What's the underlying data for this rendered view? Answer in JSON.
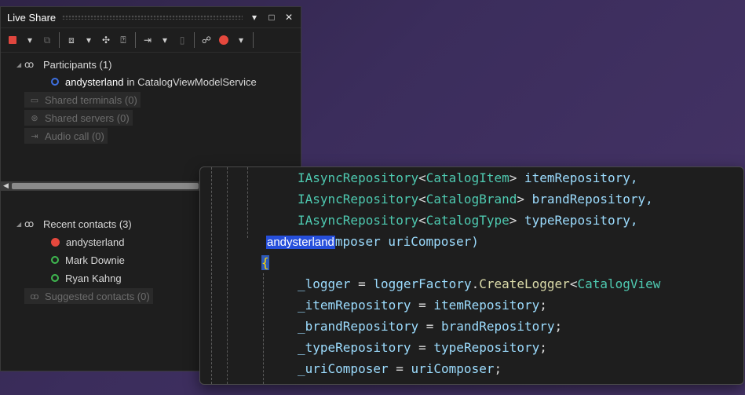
{
  "panel": {
    "title": "Live Share",
    "participants_label": "Participants (1)",
    "participant": {
      "name": "andysterland",
      "location": "in CatalogViewModelService"
    },
    "shared_terminals": "Shared terminals (0)",
    "shared_servers": "Shared servers (0)",
    "audio_call": "Audio call (0)",
    "recent_contacts_label": "Recent contacts (3)",
    "recent_contacts": [
      "andysterland",
      "Mark Downie",
      "Ryan Kahng"
    ],
    "suggested_contacts": "Suggested contacts (0)"
  },
  "editor": {
    "line1": {
      "type": "IAsyncRepository",
      "lt": "<",
      "generic": "CatalogItem",
      "gt": ">",
      "param": " itemRepository,",
      "indent": "        "
    },
    "line2": {
      "type": "IAsyncRepository",
      "lt": "<",
      "generic": "CatalogBrand",
      "gt": ">",
      "param": " brandRepository,",
      "indent": "        "
    },
    "line3": {
      "type": "IAsyncRepository",
      "lt": "<",
      "generic": "CatalogType",
      "gt": ">",
      "param": " typeRepository,",
      "indent": "        "
    },
    "line4": {
      "cursor_name": "andysterland",
      "rest": "mposer uriComposer)"
    },
    "line5": {
      "brace": "{"
    },
    "line6": {
      "lhs": "_logger",
      "eq": " = ",
      "obj": "loggerFactory",
      "dot": ".",
      "method": "CreateLogger",
      "lt": "<",
      "generic": "CatalogView"
    },
    "line7": {
      "lhs": "_itemRepository",
      "eq": " = ",
      "rhs": "itemRepository",
      "semi": ";"
    },
    "line8": {
      "lhs": "_brandRepository",
      "eq": " = ",
      "rhs": "brandRepository",
      "semi": ";"
    },
    "line9": {
      "lhs": "_typeRepository",
      "eq": " = ",
      "rhs": "typeRepository",
      "semi": ";"
    },
    "line10": {
      "lhs": "_uriComposer",
      "eq": " = ",
      "rhs": "uriComposer",
      "semi": ";"
    }
  },
  "colors": {
    "accent": "#264fdb",
    "stop_red": "#e0463e",
    "participant_blue": "#3d6fe0",
    "online_green": "#3fb950"
  }
}
